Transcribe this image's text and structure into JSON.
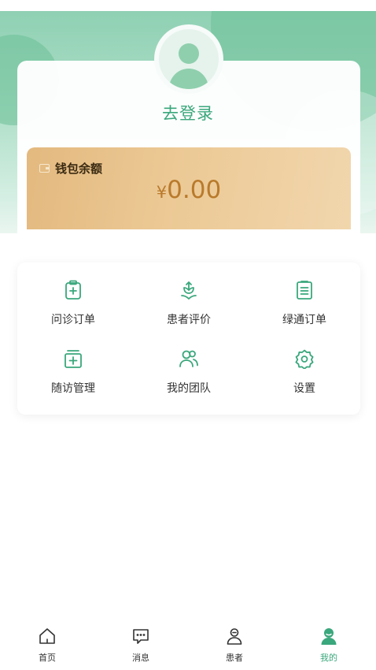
{
  "header": {
    "login_label": "去登录"
  },
  "wallet": {
    "label": "钱包余额",
    "currency_symbol": "¥",
    "amount": "0.00"
  },
  "menu": {
    "items": [
      {
        "label": "问诊订单",
        "icon": "clipboard-plus-icon"
      },
      {
        "label": "患者评价",
        "icon": "flower-icon"
      },
      {
        "label": "绿通订单",
        "icon": "document-list-icon"
      },
      {
        "label": "随访管理",
        "icon": "medical-box-icon"
      },
      {
        "label": "我的团队",
        "icon": "team-icon"
      },
      {
        "label": "设置",
        "icon": "gear-icon"
      }
    ]
  },
  "tabbar": {
    "items": [
      {
        "label": "首页",
        "icon": "home-icon",
        "active": false
      },
      {
        "label": "消息",
        "icon": "message-icon",
        "active": false
      },
      {
        "label": "患者",
        "icon": "patient-icon",
        "active": false
      },
      {
        "label": "我的",
        "icon": "profile-icon",
        "active": true
      }
    ]
  },
  "colors": {
    "accent": "#3aa77c",
    "banner": "#8fd0b3",
    "wallet_text": "#b97a2c"
  }
}
